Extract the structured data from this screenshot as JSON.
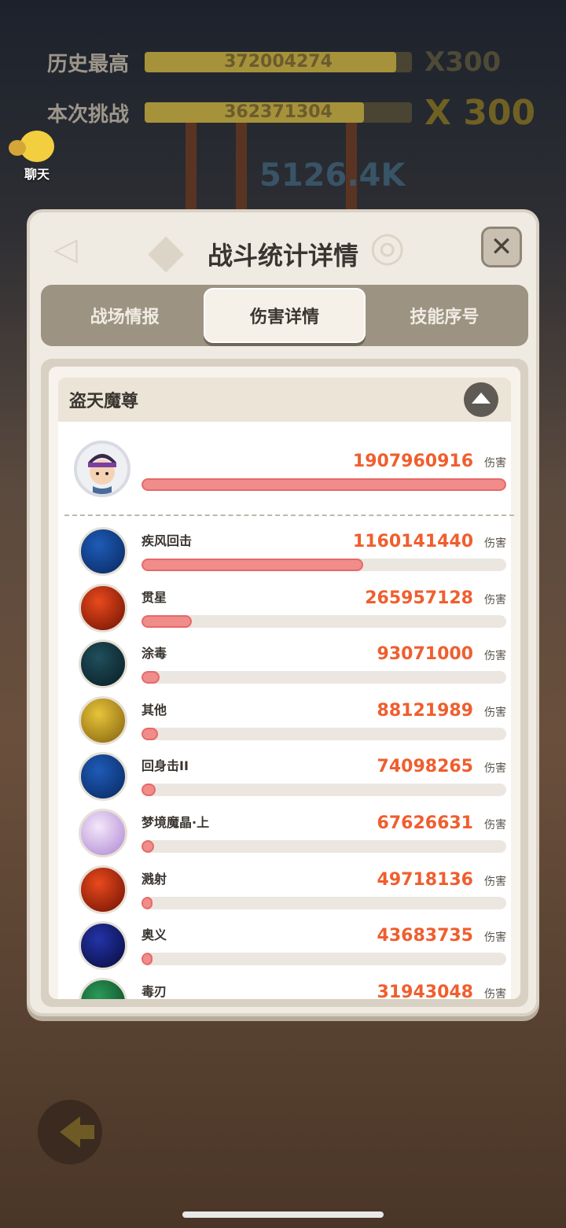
{
  "background": {
    "history_label": "历史最高",
    "history_value": "372004274",
    "history_mult": "X300",
    "current_label": "本次挑战",
    "current_value": "362371304",
    "current_mult": "X 300",
    "damage_popup": "5126.4K",
    "chat_label": "聊天"
  },
  "modal": {
    "title": "战斗统计详情",
    "close_label": "✕",
    "tabs": [
      {
        "label": "战场情报",
        "active": false
      },
      {
        "label": "伤害详情",
        "active": true
      },
      {
        "label": "技能序号",
        "active": false
      }
    ],
    "group_name": "盗天魔尊",
    "unit": "伤害",
    "hero": {
      "value": "1907960916",
      "ratio": 1.0
    },
    "skills": [
      {
        "name": "疾风回击",
        "value": "1160141440",
        "ratio": 0.608,
        "icon": "wind-strike-icon",
        "c1": "#1e5bb8",
        "c2": "#0b2d66"
      },
      {
        "name": "贯星",
        "value": "265957128",
        "ratio": 0.139,
        "icon": "star-pierce-icon",
        "c1": "#e84a1c",
        "c2": "#7a1606"
      },
      {
        "name": "涂毒",
        "value": "93071000",
        "ratio": 0.049,
        "icon": "poison-drop-icon",
        "c1": "#1f4f5c",
        "c2": "#0b2129"
      },
      {
        "name": "其他",
        "value": "88121989",
        "ratio": 0.046,
        "icon": "box-icon",
        "c1": "#e7c43a",
        "c2": "#8c6a12"
      },
      {
        "name": "回身击II",
        "value": "74098265",
        "ratio": 0.039,
        "icon": "spin-strike-icon",
        "c1": "#1e5bb8",
        "c2": "#0b2d66"
      },
      {
        "name": "梦境魔晶·上",
        "value": "67626631",
        "ratio": 0.035,
        "icon": "dream-crystal-icon",
        "c1": "#f4e7f9",
        "c2": "#b48fd8"
      },
      {
        "name": "溅射",
        "value": "49718136",
        "ratio": 0.026,
        "icon": "splash-icon",
        "c1": "#e84a1c",
        "c2": "#7a1606"
      },
      {
        "name": "奥义",
        "value": "43683735",
        "ratio": 0.023,
        "icon": "vortex-icon",
        "c1": "#2433a8",
        "c2": "#0a0f45"
      },
      {
        "name": "毒刃",
        "value": "31943048",
        "ratio": 0.017,
        "icon": "poison-blade-icon",
        "c1": "#2a9a58",
        "c2": "#0f4a27"
      }
    ]
  }
}
